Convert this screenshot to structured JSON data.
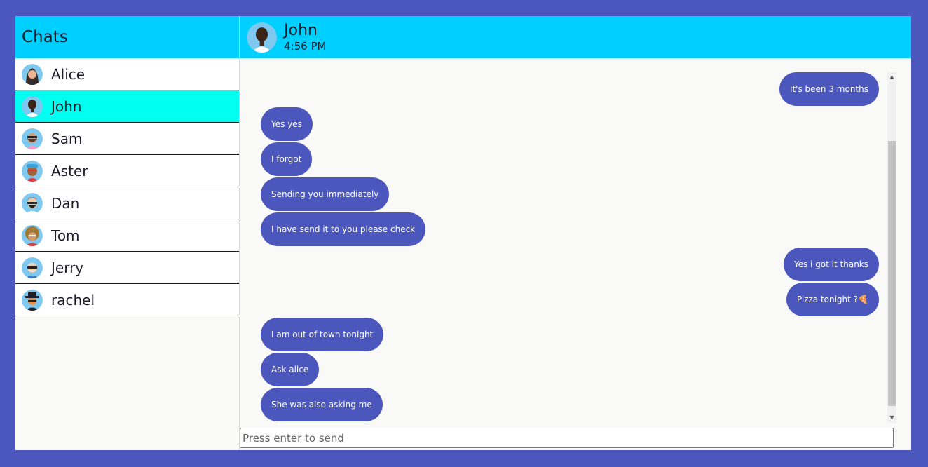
{
  "sidebar": {
    "title": "Chats",
    "contacts": [
      {
        "name": "Alice",
        "avatar_icon": "woman-avatar-icon"
      },
      {
        "name": "John",
        "avatar_icon": "bald-man-avatar-icon",
        "active": true
      },
      {
        "name": "Sam",
        "avatar_icon": "sunglasses-man-avatar-icon"
      },
      {
        "name": "Aster",
        "avatar_icon": "beanie-man-avatar-icon"
      },
      {
        "name": "Dan",
        "avatar_icon": "redhead-man-avatar-icon"
      },
      {
        "name": "Tom",
        "avatar_icon": "curly-man-avatar-icon"
      },
      {
        "name": "Jerry",
        "avatar_icon": "grey-man-avatar-icon"
      },
      {
        "name": "rachel",
        "avatar_icon": "hat-person-avatar-icon"
      }
    ]
  },
  "chat": {
    "contact_name": "John",
    "time": "4:56 PM",
    "messages": [
      {
        "text": "It's been 3 months",
        "side": "right"
      },
      {
        "text": "Yes yes",
        "side": "left"
      },
      {
        "text": "I forgot",
        "side": "left"
      },
      {
        "text": "Sending you immediately",
        "side": "left"
      },
      {
        "text": "I have send it to you please check",
        "side": "left"
      },
      {
        "text": "Yes i got it thanks",
        "side": "right"
      },
      {
        "text": "Pizza tonight ?🍕",
        "side": "right"
      },
      {
        "text": "I am out of town tonight",
        "side": "left"
      },
      {
        "text": "Ask alice",
        "side": "left"
      },
      {
        "text": "She was also asking me",
        "side": "left"
      }
    ]
  },
  "composer": {
    "placeholder": "Press enter to send"
  },
  "colors": {
    "background": "#4b57bd",
    "header": "#00d0ff",
    "active_contact": "#00fff0",
    "bubble": "#4b57bd"
  }
}
